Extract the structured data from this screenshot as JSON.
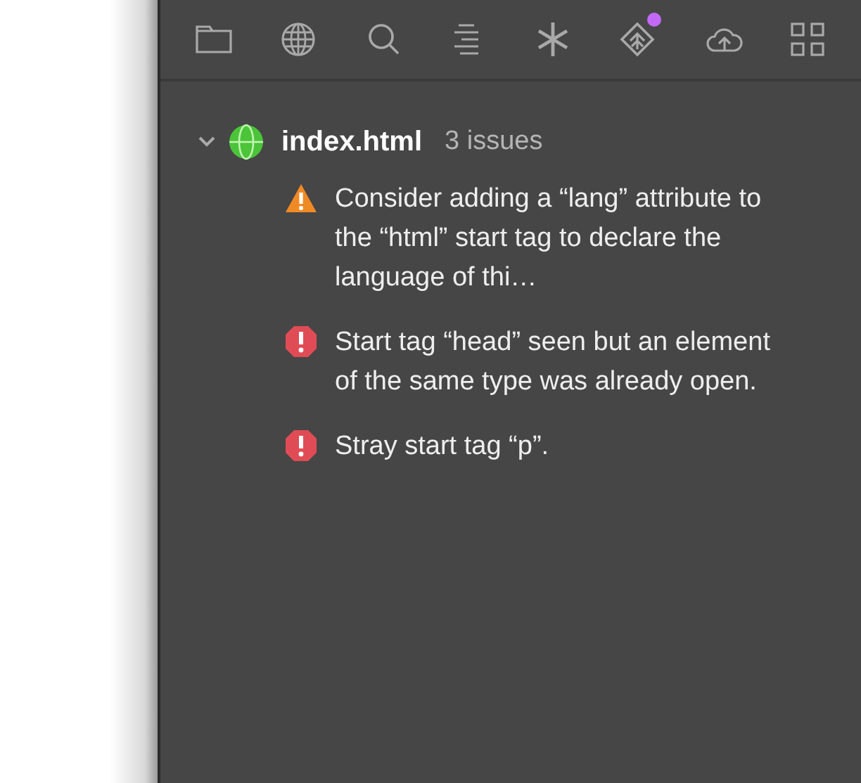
{
  "toolbar": [
    {
      "kind": "folder",
      "badge": false
    },
    {
      "kind": "globe",
      "badge": false
    },
    {
      "kind": "search",
      "badge": false
    },
    {
      "kind": "lines",
      "badge": false
    },
    {
      "kind": "asterisk",
      "badge": false
    },
    {
      "kind": "diamond",
      "badge": true
    },
    {
      "kind": "cloud",
      "badge": false
    },
    {
      "kind": "grid",
      "badge": false
    }
  ],
  "file": {
    "name": "index.html",
    "count": "3 issues",
    "expanded": true
  },
  "issues": [
    {
      "kind": "warning",
      "text": "Consider adding a “lang” attribute to the “html” start tag to declare the language of thi…"
    },
    {
      "kind": "error",
      "text": "Start tag “head” seen but an element of the same type was already open."
    },
    {
      "kind": "error",
      "text": "Stray start tag “p”."
    }
  ]
}
